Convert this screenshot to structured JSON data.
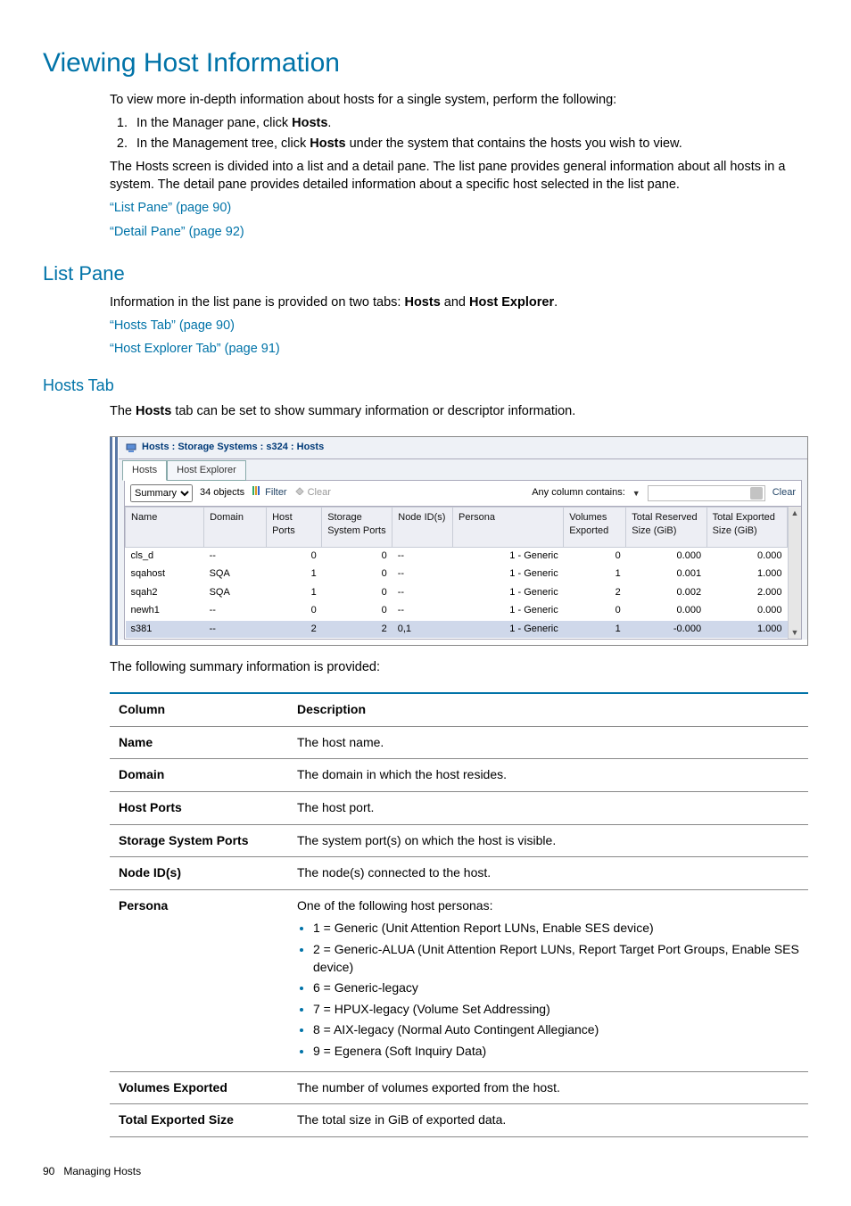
{
  "page": {
    "title": "Viewing Host Information",
    "intro": "To view more in-depth information about hosts for a single system, perform the following:",
    "steps": {
      "s1a": "In the Manager pane, click ",
      "s1b": "Hosts",
      "s1c": ".",
      "s2a": "In the Management tree, click ",
      "s2b": "Hosts",
      "s2c": " under the system that contains the hosts you wish to view."
    },
    "para2": "The Hosts screen is divided into a list and a detail pane. The list pane provides general information about all hosts in a system. The detail pane provides detailed information about a specific host selected in the list pane.",
    "link_listpane": "“List Pane” (page 90)",
    "link_detailpane": "“Detail Pane” (page 92)"
  },
  "listpane": {
    "heading": "List Pane",
    "intro_a": "Information in the list pane is provided on two tabs: ",
    "intro_b": "Hosts",
    "intro_c": " and ",
    "intro_d": "Host Explorer",
    "intro_e": ".",
    "link_hoststab": "“Hosts Tab” (page 90)",
    "link_explorertab": "“Host Explorer Tab” (page 91)"
  },
  "hoststab": {
    "heading": "Hosts Tab",
    "intro_a": "The ",
    "intro_b": "Hosts",
    "intro_c": " tab can be set to show summary information or descriptor information."
  },
  "shot": {
    "breadcrumb": "Hosts : Storage Systems : s324 : Hosts",
    "tab1": "Hosts",
    "tab2": "Host Explorer",
    "view_selected": "Summary",
    "objects": "34 objects",
    "filter": "Filter",
    "clear": "Clear",
    "anycol": "Any column contains:",
    "clear2": "Clear",
    "cols": {
      "c0": "Name",
      "c1": "Domain",
      "c2": "Host Ports",
      "c3": "Storage System Ports",
      "c4": "Node ID(s)",
      "c5": "Persona",
      "c6": "Volumes Exported",
      "c7": "Total Reserved Size (GiB)",
      "c8": "Total Exported Size (GiB)"
    },
    "rows": [
      {
        "name": "cls_d",
        "domain": "--",
        "hp": "0",
        "ssp": "0",
        "nid": "--",
        "persona": "1 - Generic",
        "ve": "0",
        "trs": "0.000",
        "tes": "0.000"
      },
      {
        "name": "sqahost",
        "domain": "SQA",
        "hp": "1",
        "ssp": "0",
        "nid": "--",
        "persona": "1 - Generic",
        "ve": "1",
        "trs": "0.001",
        "tes": "1.000"
      },
      {
        "name": "sqah2",
        "domain": "SQA",
        "hp": "1",
        "ssp": "0",
        "nid": "--",
        "persona": "1 - Generic",
        "ve": "2",
        "trs": "0.002",
        "tes": "2.000"
      },
      {
        "name": "newh1",
        "domain": "--",
        "hp": "0",
        "ssp": "0",
        "nid": "--",
        "persona": "1 - Generic",
        "ve": "0",
        "trs": "0.000",
        "tes": "0.000"
      },
      {
        "name": "s381",
        "domain": "--",
        "hp": "2",
        "ssp": "2",
        "nid": "0,1",
        "persona": "1 - Generic",
        "ve": "1",
        "trs": "-0.000",
        "tes": "1.000"
      }
    ]
  },
  "follow": "The following summary information is provided:",
  "infotable": {
    "h1": "Column",
    "h2": "Description",
    "rows": {
      "name": {
        "c": "Name",
        "d": "The host name."
      },
      "domain": {
        "c": "Domain",
        "d": "The domain in which the host resides."
      },
      "hostports": {
        "c": "Host Ports",
        "d": "The host port."
      },
      "ssp": {
        "c": "Storage System Ports",
        "d": "The system port(s) on which the host is visible."
      },
      "nid": {
        "c": "Node ID(s)",
        "d": "The node(s) connected to the host."
      },
      "persona": {
        "c": "Persona",
        "lead": "One of the following host personas:",
        "i1": "1 = Generic (Unit Attention Report LUNs, Enable SES device)",
        "i2": "2 = Generic-ALUA (Unit Attention Report LUNs, Report Target Port Groups, Enable SES device)",
        "i3": "6 = Generic-legacy",
        "i4": "7 = HPUX-legacy (Volume Set Addressing)",
        "i5": "8 = AIX-legacy (Normal Auto Contingent Allegiance)",
        "i6": "9 = Egenera (Soft Inquiry Data)"
      },
      "ve": {
        "c": "Volumes Exported",
        "d": "The number of volumes exported from the host."
      },
      "tes": {
        "c": "Total Exported Size",
        "d": "The total size in GiB of exported data."
      }
    }
  },
  "footer": {
    "page": "90",
    "section": "Managing Hosts"
  }
}
